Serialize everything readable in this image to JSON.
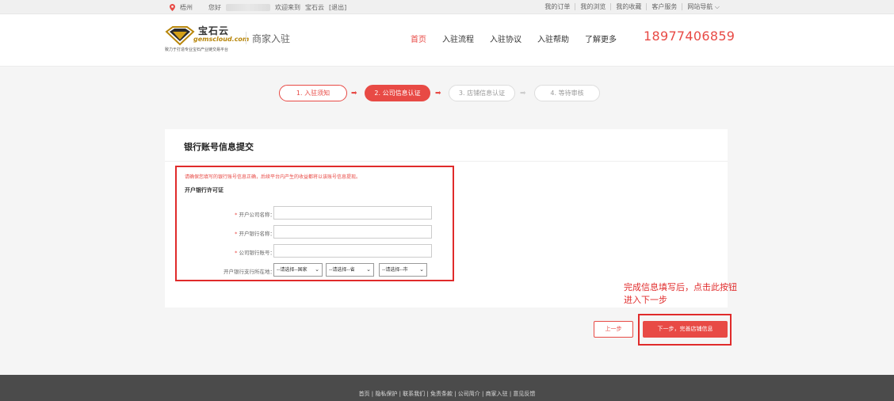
{
  "topbar": {
    "location": "梧州",
    "greeting": "您好",
    "welcome": "欢迎来到",
    "site": "宝石云",
    "logout": "[退出]",
    "links": [
      "我的订单",
      "我的浏览",
      "我的收藏",
      "客户服务",
      "网站导航"
    ]
  },
  "header": {
    "brand": "宝石云",
    "domain": "gemscloud.com",
    "tagline": "致力于打造专业宝石产业链交易平台",
    "merchant_title": "商家入驻",
    "nav": [
      "首页",
      "入驻流程",
      "入驻协议",
      "入驻帮助",
      "了解更多"
    ],
    "phone": "18977406859"
  },
  "steps": [
    {
      "label": "1. 入驻须知",
      "state": "done"
    },
    {
      "label": "2. 公司信息认证",
      "state": "current"
    },
    {
      "label": "3. 店铺信息认证",
      "state": "todo"
    },
    {
      "label": "4. 等待审核",
      "state": "todo"
    }
  ],
  "form": {
    "title": "银行账号信息提交",
    "warning": "请确保您填写的银行账号信息正确，后续平台内产生的收益都将以该账号信息提现。",
    "section": "开户银行许可证",
    "fields": [
      {
        "label": "开户公司名称：",
        "value": "",
        "required": "*"
      },
      {
        "label": "开户银行名称：",
        "value": "",
        "required": "*"
      },
      {
        "label": "公司银行账号：",
        "value": "",
        "required": "*"
      }
    ],
    "location_label": "开户银行支行所在地：",
    "selects": [
      "--请选择--国家",
      "--请选择--省",
      "--请选择--市"
    ]
  },
  "annotation": {
    "line1": "完成信息填写后，点击此按钮",
    "line2": "进入下一步"
  },
  "buttons": {
    "prev": "上一步",
    "next": "下一步，完善店铺信息"
  },
  "footer": {
    "links": "首页 | 隐私保护 | 联系我们 | 免责条款 | 公司简介 | 商家入驻 | 意见反馈"
  },
  "colors": {
    "accent": "#e84a45",
    "highlight_box": "#e02b2b"
  }
}
